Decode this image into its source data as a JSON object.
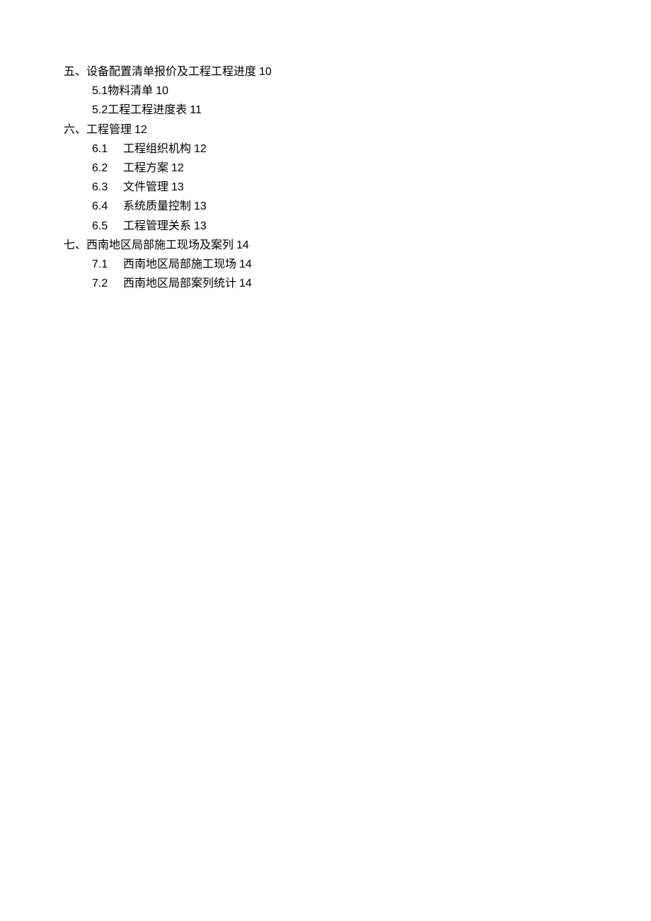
{
  "sections": [
    {
      "label": "五、",
      "title": "设备配置清单报价及工程工程进度",
      "page": "10",
      "items": [
        {
          "num": "5.1",
          "title": "物料清单",
          "page": "10"
        },
        {
          "num": "5.2",
          "title": "工程工程进度表",
          "page": "11"
        }
      ]
    },
    {
      "label": "六、",
      "title": "工程管理",
      "page": "12",
      "items": [
        {
          "num": "6.1",
          "title": "工程组织机构",
          "page": "12"
        },
        {
          "num": "6.2",
          "title": "工程方案",
          "page": "12"
        },
        {
          "num": "6.3",
          "title": "文件管理",
          "page": "13"
        },
        {
          "num": "6.4",
          "title": "系统质量控制",
          "page": "13"
        },
        {
          "num": "6.5",
          "title": "工程管理关系",
          "page": "13"
        }
      ]
    },
    {
      "label": "七、",
      "title": "西南地区局部施工现场及案列",
      "page": "14",
      "items": [
        {
          "num": "7.1",
          "title": "西南地区局部施工现场",
          "page": "14"
        },
        {
          "num": "7.2",
          "title": "西南地区局部案列统计",
          "page": "14"
        }
      ]
    }
  ]
}
